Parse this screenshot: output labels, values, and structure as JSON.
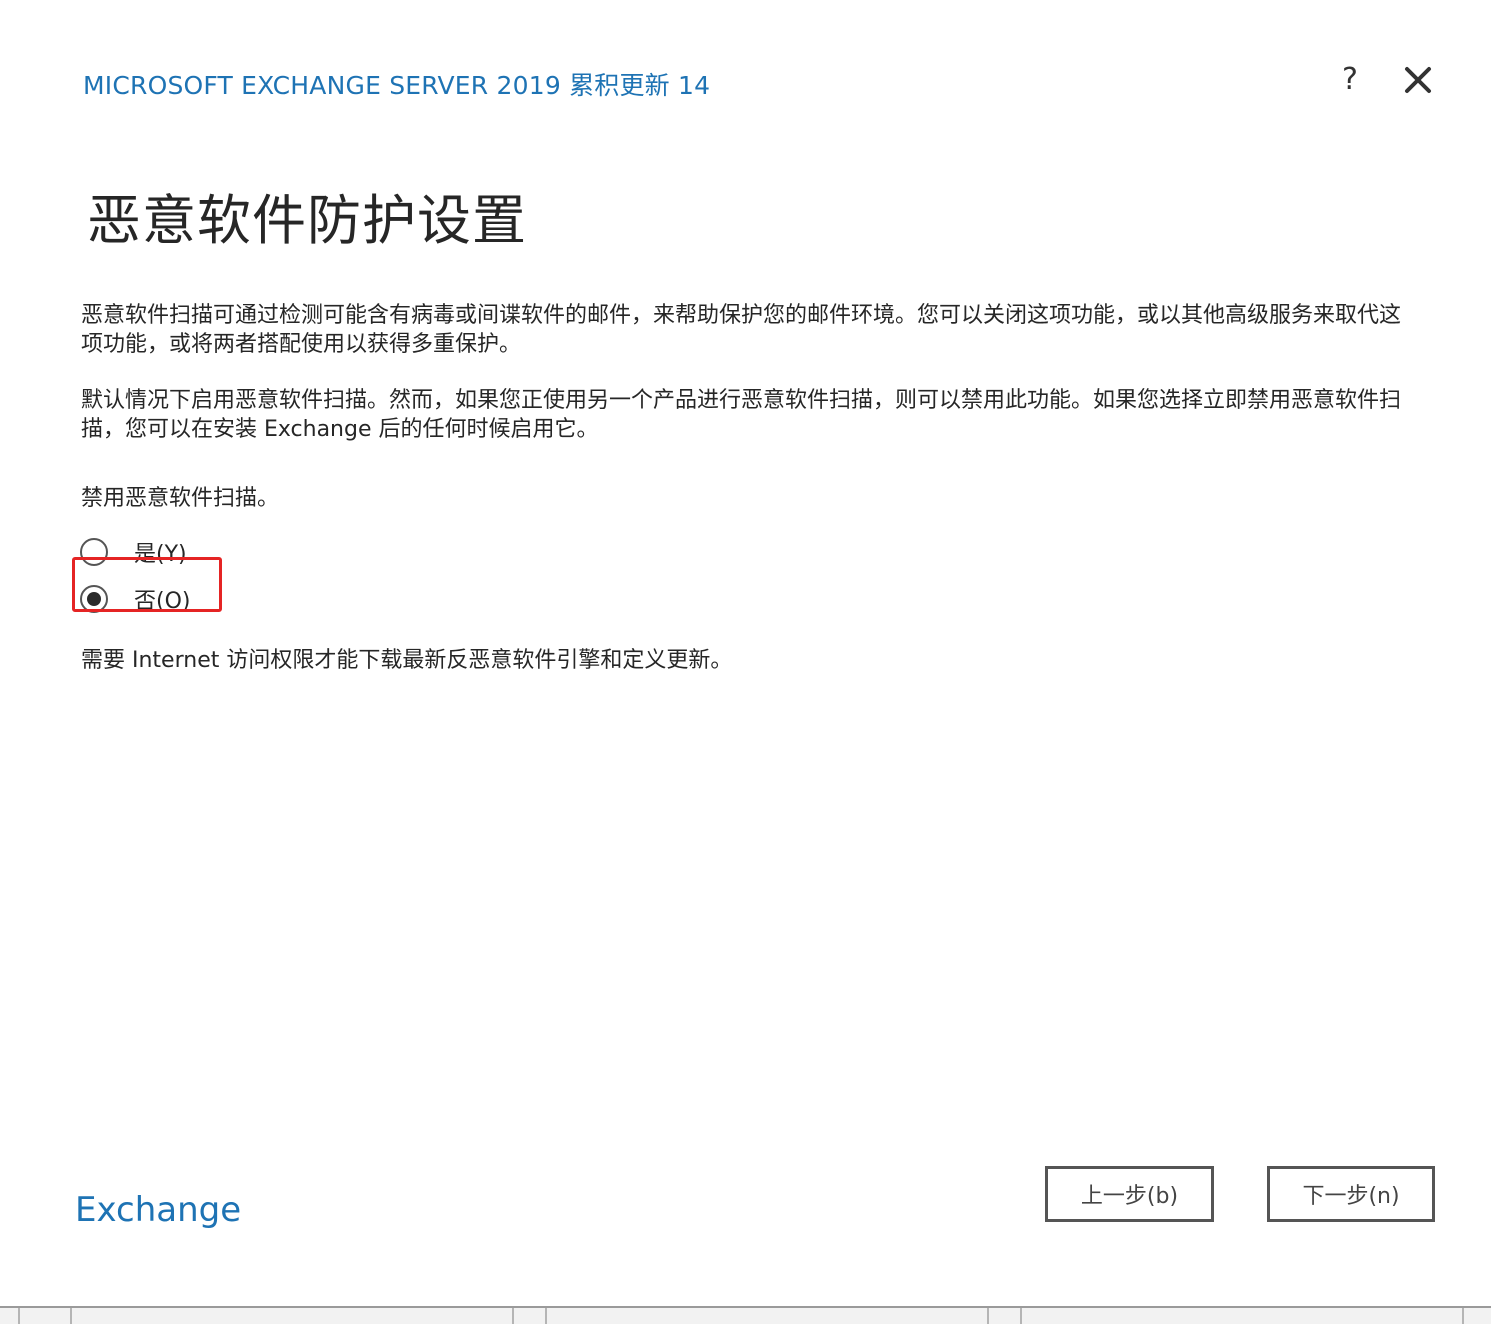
{
  "window": {
    "app_title": "MICROSOFT EXCHANGE SERVER 2019 累积更新 14",
    "help_label": "?",
    "close_icon": "close-icon"
  },
  "page": {
    "title": "恶意软件防护设置",
    "paragraph_1": "恶意软件扫描可通过检测可能含有病毒或间谍软件的邮件，来帮助保护您的邮件环境。您可以关闭这项功能，或以其他高级服务来取代这项功能，或将两者搭配使用以获得多重保护。",
    "paragraph_2": "默认情况下启用恶意软件扫描。然而，如果您正使用另一个产品进行恶意软件扫描，则可以禁用此功能。如果您选择立即禁用恶意软件扫描，您可以在安装 Exchange 后的任何时候启用它。",
    "question": "禁用恶意软件扫描。",
    "options": [
      {
        "label": "是(Y)",
        "selected": false
      },
      {
        "label": "否(O)",
        "selected": true
      }
    ],
    "note": "需要 Internet 访问权限才能下载最新反恶意软件引擎和定义更新。"
  },
  "footer": {
    "brand": "Exchange",
    "back_label": "上一步(b)",
    "next_label": "下一步(n)"
  },
  "colors": {
    "accent": "#1e73b4",
    "highlight": "#e52424"
  }
}
